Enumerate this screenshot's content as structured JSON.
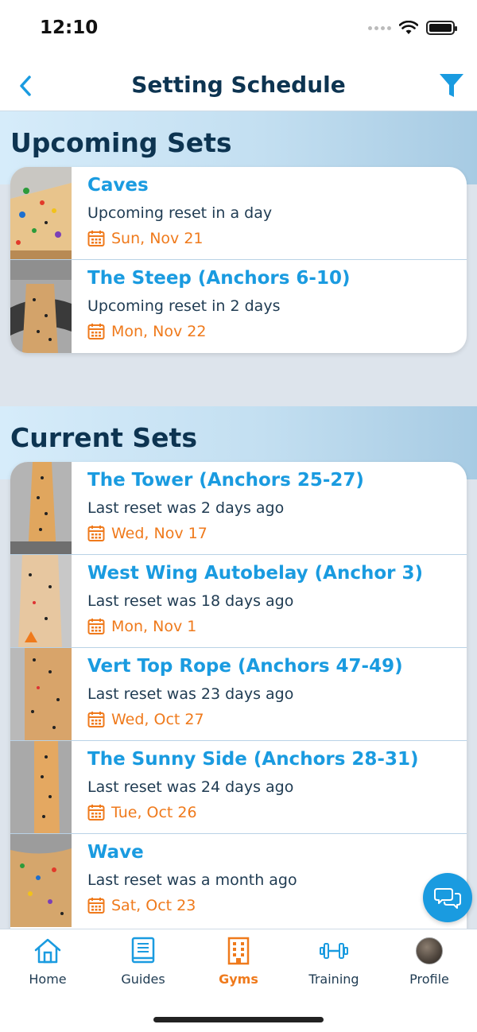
{
  "status_bar": {
    "time": "12:10"
  },
  "nav": {
    "title": "Setting Schedule"
  },
  "sections": {
    "upcoming": {
      "title": "Upcoming Sets",
      "items": [
        {
          "title": "Caves",
          "subtitle": "Upcoming reset in a day",
          "date": "Sun, Nov 21"
        },
        {
          "title": "The Steep (Anchors 6-10)",
          "subtitle": "Upcoming reset in 2 days",
          "date": "Mon, Nov 22"
        }
      ]
    },
    "current": {
      "title": "Current Sets",
      "items": [
        {
          "title": "The Tower (Anchors 25-27)",
          "subtitle": "Last reset was 2 days ago",
          "date": "Wed, Nov 17"
        },
        {
          "title": "West Wing Autobelay (Anchor 3)",
          "subtitle": "Last reset was 18 days ago",
          "date": "Mon, Nov 1"
        },
        {
          "title": "Vert Top Rope (Anchors 47-49)",
          "subtitle": "Last reset was 23 days ago",
          "date": "Wed, Oct 27"
        },
        {
          "title": "The Sunny Side (Anchors 28-31)",
          "subtitle": "Last reset was 24 days ago",
          "date": "Tue, Oct 26"
        },
        {
          "title": "Wave",
          "subtitle": "Last reset was a month ago",
          "date": "Sat, Oct 23"
        }
      ]
    }
  },
  "tabs": [
    {
      "label": "Home",
      "icon": "home-icon"
    },
    {
      "label": "Guides",
      "icon": "book-icon"
    },
    {
      "label": "Gyms",
      "icon": "building-icon",
      "active": true
    },
    {
      "label": "Training",
      "icon": "dumbbell-icon"
    },
    {
      "label": "Profile",
      "icon": "avatar"
    }
  ],
  "colors": {
    "accent_blue": "#1a9be0",
    "accent_orange": "#ef7a1c",
    "title_navy": "#0d3451"
  }
}
